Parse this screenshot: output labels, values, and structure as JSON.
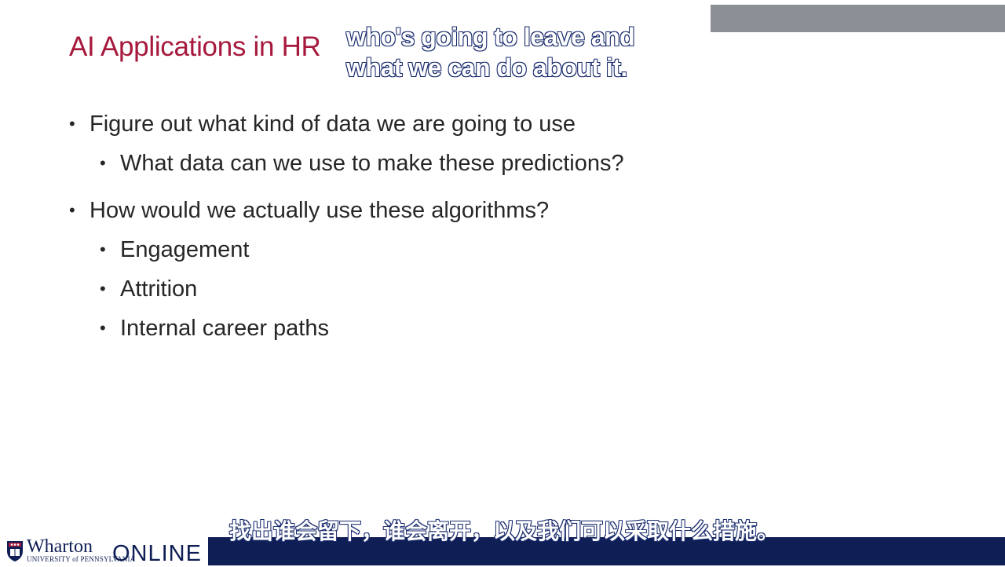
{
  "slide": {
    "title": "AI Applications in HR",
    "bullets": [
      {
        "level": 1,
        "text": "Figure out what kind of data we are going to use"
      },
      {
        "level": 2,
        "text": "What data can we use to make these predictions?"
      },
      {
        "level": 1,
        "text": "How would we actually use these algorithms?"
      },
      {
        "level": 2,
        "text": "Engagement"
      },
      {
        "level": 2,
        "text": "Attrition"
      },
      {
        "level": 2,
        "text": "Internal career paths"
      }
    ],
    "bullet_glyph": "•"
  },
  "captions": {
    "english_line1": "who's going to leave and",
    "english_line2": "what we can do about it.",
    "chinese": "找出谁会留下，谁会离开，以及我们可以采取什么措施。"
  },
  "branding": {
    "wharton": "Wharton",
    "university": "UNIVERSITY of PENNSYLVANIA",
    "online": "ONLINE",
    "shield_icon": "penn-shield-icon"
  },
  "colors": {
    "title": "#a6193c",
    "top_bar": "#8c8f96",
    "bottom_bar": "#0f1e55",
    "body_text": "#262626",
    "caption_outline": "#1a2c6e"
  }
}
